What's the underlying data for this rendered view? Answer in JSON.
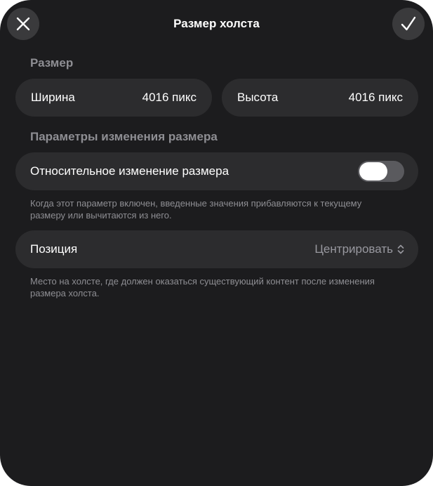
{
  "dialog": {
    "title": "Размер холста",
    "close_icon": "close-icon",
    "done_icon": "checkmark-icon"
  },
  "size_section": {
    "header": "Размер",
    "width_label": "Ширина",
    "width_value": "4016 пикс",
    "height_label": "Высота",
    "height_value": "4016 пикс"
  },
  "params_section": {
    "header": "Параметры изменения размера",
    "relative_label": "Относительное изменение размера",
    "relative_enabled": false,
    "relative_note": "Когда этот параметр включен, введенные значения прибавляются к текущему размеру или вычитаются из него.",
    "position_label": "Позиция",
    "position_value": "Центрировать",
    "position_icon": "chevron-up-down-icon",
    "position_note": "Место на холсте, где должен оказаться существующий контент после изменения размера холста."
  },
  "colors": {
    "background": "#1c1c1e",
    "field": "#2c2c2e",
    "button": "#3a3a3c",
    "secondary_text": "#8e8e93",
    "toggle_off": "#5a5a5e"
  }
}
